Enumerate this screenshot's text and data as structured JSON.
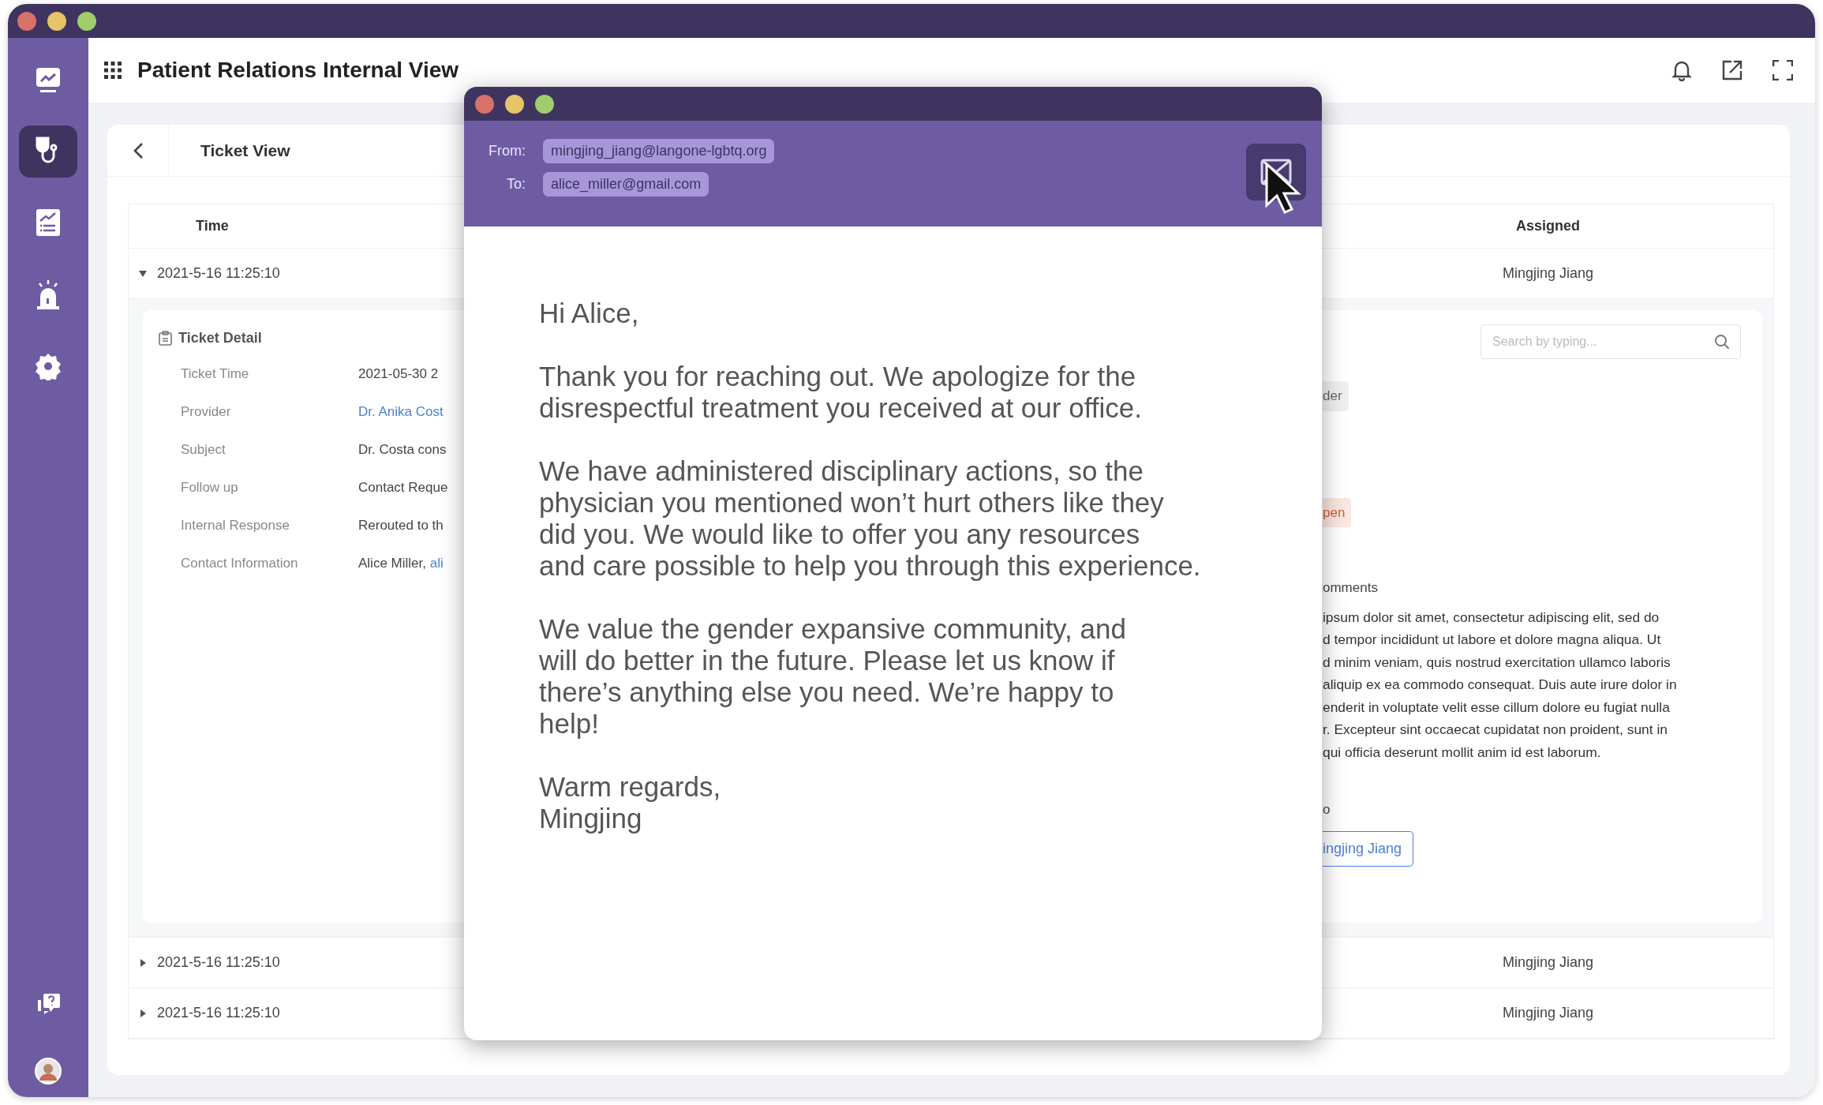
{
  "window": {
    "title": "Patient Relations Internal View"
  },
  "sidebar": {
    "items": [
      {
        "kind": "monitor",
        "selected": false
      },
      {
        "kind": "stethoscope",
        "selected": true
      },
      {
        "kind": "report",
        "selected": false
      },
      {
        "kind": "alarm",
        "selected": false
      },
      {
        "kind": "settings",
        "selected": false
      },
      {
        "kind": "help",
        "selected": false
      },
      {
        "kind": "avatar",
        "selected": false
      }
    ]
  },
  "ticket_view": {
    "title": "Ticket View"
  },
  "table": {
    "columns": [
      "Time",
      "Assigned"
    ],
    "rows": [
      {
        "time": "2021-5-16 11:25:10",
        "assigned": "Mingjing Jiang",
        "expanded": true
      },
      {
        "time": "2021-5-16 11:25:10",
        "assigned": "Mingjing Jiang",
        "expanded": false
      },
      {
        "time": "2021-5-16 11:25:10",
        "assigned": "Mingjing Jiang",
        "expanded": false
      }
    ]
  },
  "detail": {
    "title": "Ticket Detail",
    "fields": [
      {
        "label": "Ticket Time",
        "value": "2021-05-30 2",
        "kind": "text"
      },
      {
        "label": "Provider",
        "value": "Dr. Anika Cost",
        "kind": "link"
      },
      {
        "label": "Subject",
        "value": "Dr. Costa cons",
        "kind": "text"
      },
      {
        "label": "Follow up",
        "value": "Contact Reque",
        "kind": "text"
      },
      {
        "label": "Internal Response",
        "value": "Rerouted to th",
        "kind": "text"
      },
      {
        "label": "Contact Information",
        "value": "Alice Miller,",
        "link": "ali",
        "kind": "text"
      }
    ]
  },
  "side_panel": {
    "search": {
      "placeholder": "Search by typing..."
    },
    "tags": [
      {
        "text": "der",
        "color": "#f0f0f0"
      },
      {
        "text": "pen",
        "color": "#fbe6e1"
      }
    ],
    "comments_label": "omments",
    "comments": "ipsum dolor sit amet, consectetur adipiscing elit, sed do\nd tempor incididunt ut labore et dolore magna aliqua. Ut\nd minim veniam, quis nostrud exercitation ullamco laboris\naliquip ex ea commodo consequat. Duis aute irure dolor in\nenderit in voluptate velit esse cillum dolore eu fugiat nulla\nr. Excepteur sint occaecat cupidatat non proident, sunt in\nqui officia deserunt mollit anim id est laborum.",
    "assign_label": "o",
    "assign_button": "ingjing Jiang"
  },
  "email": {
    "from_label": "From:",
    "from": "mingjing_jiang@langone-lgbtq.org",
    "to_label": "To:",
    "to": "alice_miller@gmail.com",
    "paragraphs": [
      "Hi Alice,",
      "Thank you for reaching out. We apologize for the\ndisrespectful treatment you received at our office.",
      "We have administered disciplinary actions, so the\nphysician you mentioned won’t hurt others like they\ndid you. We would like to offer you any resources\nand care possible to help you through this experience.",
      "We value the gender expansive community, and\nwill do better in the future. Please let us know if\nthere’s anything else you need. We’re happy to\nhelp!",
      "Warm regards,\nMingjing"
    ]
  }
}
